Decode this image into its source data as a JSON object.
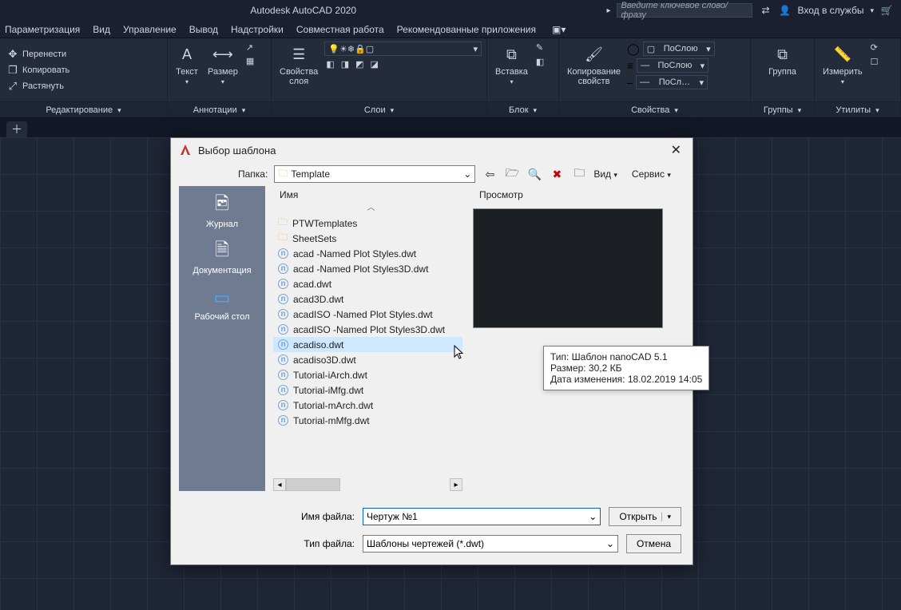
{
  "app": {
    "title": "Autodesk AutoCAD 2020"
  },
  "title_right": {
    "search_placeholder": "Введите ключевое слово/фразу",
    "login": "Вход в службы"
  },
  "menubar": [
    "Параметризация",
    "Вид",
    "Управление",
    "Вывод",
    "Надстройки",
    "Совместная работа",
    "Рекомендованные приложения"
  ],
  "ribbon": {
    "edit": {
      "title": "Редактирование",
      "move": "Перенести",
      "copy": "Копировать",
      "stretch": "Растянуть"
    },
    "annot": {
      "title": "Аннотации",
      "text": "Текст",
      "dim": "Размер"
    },
    "layers": {
      "title": "Слои",
      "props": "Свойства\nслоя"
    },
    "block": {
      "title": "Блок",
      "insert": "Вставка"
    },
    "props": {
      "title": "Свойства",
      "copyprops": "Копирование\nсвойств",
      "bylayer": "ПоСлою",
      "bylayer2": "ПоСлою",
      "bylayer3": "ПоСл…"
    },
    "groups": {
      "title": "Группы",
      "group": "Группа"
    },
    "utils": {
      "title": "Утилиты",
      "measure": "Измерить"
    }
  },
  "dialog": {
    "title": "Выбор шаблона",
    "folder_label": "Папка:",
    "folder_value": "Template",
    "view_label": "Вид",
    "service_label": "Сервис",
    "places": {
      "history": "Журнал",
      "docs": "Документация",
      "desktop": "Рабочий стол"
    },
    "col_name": "Имя",
    "preview_label": "Просмотр",
    "files": [
      {
        "type": "folder",
        "name": "PTWTemplates"
      },
      {
        "type": "folder",
        "name": "SheetSets"
      },
      {
        "type": "dwt",
        "name": "acad -Named Plot Styles.dwt"
      },
      {
        "type": "dwt",
        "name": "acad -Named Plot Styles3D.dwt"
      },
      {
        "type": "dwt",
        "name": "acad.dwt"
      },
      {
        "type": "dwt",
        "name": "acad3D.dwt"
      },
      {
        "type": "dwt",
        "name": "acadISO -Named Plot Styles.dwt"
      },
      {
        "type": "dwt",
        "name": "acadISO -Named Plot Styles3D.dwt"
      },
      {
        "type": "dwt",
        "name": "acadiso.dwt",
        "selected": true
      },
      {
        "type": "dwt",
        "name": "acadiso3D.dwt"
      },
      {
        "type": "dwt",
        "name": "Tutorial-iArch.dwt"
      },
      {
        "type": "dwt",
        "name": "Tutorial-iMfg.dwt"
      },
      {
        "type": "dwt",
        "name": "Tutorial-mArch.dwt"
      },
      {
        "type": "dwt",
        "name": "Tutorial-mMfg.dwt"
      }
    ],
    "tooltip": {
      "line1": "Тип: Шаблон nanoCAD 5.1",
      "line2": "Размер: 30,2 КБ",
      "line3": "Дата изменения: 18.02.2019 14:05"
    },
    "file_name_label": "Имя файла:",
    "file_name_value": "Чертуж №1",
    "file_type_label": "Тип файла:",
    "file_type_value": "Шаблоны чертежей (*.dwt)",
    "open_btn": "Открыть",
    "cancel_btn": "Отмена"
  }
}
